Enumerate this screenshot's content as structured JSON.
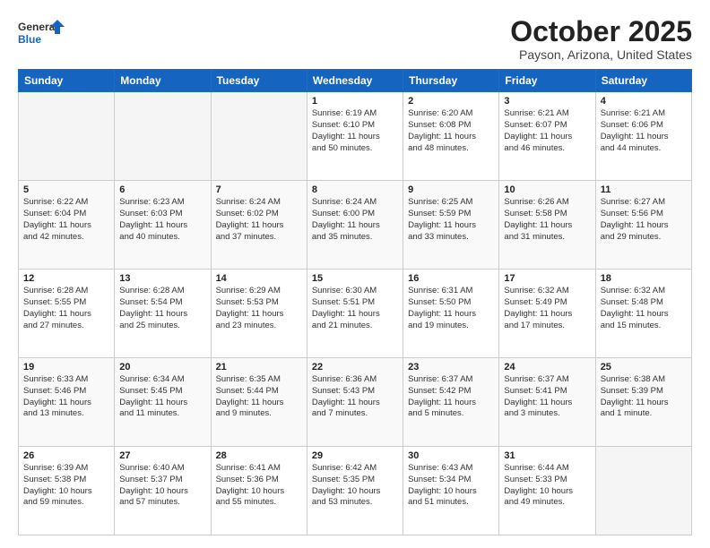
{
  "header": {
    "logo_general": "General",
    "logo_blue": "Blue",
    "month_title": "October 2025",
    "location": "Payson, Arizona, United States"
  },
  "weekdays": [
    "Sunday",
    "Monday",
    "Tuesday",
    "Wednesday",
    "Thursday",
    "Friday",
    "Saturday"
  ],
  "weeks": [
    [
      {
        "day": "",
        "info": ""
      },
      {
        "day": "",
        "info": ""
      },
      {
        "day": "",
        "info": ""
      },
      {
        "day": "1",
        "info": "Sunrise: 6:19 AM\nSunset: 6:10 PM\nDaylight: 11 hours\nand 50 minutes."
      },
      {
        "day": "2",
        "info": "Sunrise: 6:20 AM\nSunset: 6:08 PM\nDaylight: 11 hours\nand 48 minutes."
      },
      {
        "day": "3",
        "info": "Sunrise: 6:21 AM\nSunset: 6:07 PM\nDaylight: 11 hours\nand 46 minutes."
      },
      {
        "day": "4",
        "info": "Sunrise: 6:21 AM\nSunset: 6:06 PM\nDaylight: 11 hours\nand 44 minutes."
      }
    ],
    [
      {
        "day": "5",
        "info": "Sunrise: 6:22 AM\nSunset: 6:04 PM\nDaylight: 11 hours\nand 42 minutes."
      },
      {
        "day": "6",
        "info": "Sunrise: 6:23 AM\nSunset: 6:03 PM\nDaylight: 11 hours\nand 40 minutes."
      },
      {
        "day": "7",
        "info": "Sunrise: 6:24 AM\nSunset: 6:02 PM\nDaylight: 11 hours\nand 37 minutes."
      },
      {
        "day": "8",
        "info": "Sunrise: 6:24 AM\nSunset: 6:00 PM\nDaylight: 11 hours\nand 35 minutes."
      },
      {
        "day": "9",
        "info": "Sunrise: 6:25 AM\nSunset: 5:59 PM\nDaylight: 11 hours\nand 33 minutes."
      },
      {
        "day": "10",
        "info": "Sunrise: 6:26 AM\nSunset: 5:58 PM\nDaylight: 11 hours\nand 31 minutes."
      },
      {
        "day": "11",
        "info": "Sunrise: 6:27 AM\nSunset: 5:56 PM\nDaylight: 11 hours\nand 29 minutes."
      }
    ],
    [
      {
        "day": "12",
        "info": "Sunrise: 6:28 AM\nSunset: 5:55 PM\nDaylight: 11 hours\nand 27 minutes."
      },
      {
        "day": "13",
        "info": "Sunrise: 6:28 AM\nSunset: 5:54 PM\nDaylight: 11 hours\nand 25 minutes."
      },
      {
        "day": "14",
        "info": "Sunrise: 6:29 AM\nSunset: 5:53 PM\nDaylight: 11 hours\nand 23 minutes."
      },
      {
        "day": "15",
        "info": "Sunrise: 6:30 AM\nSunset: 5:51 PM\nDaylight: 11 hours\nand 21 minutes."
      },
      {
        "day": "16",
        "info": "Sunrise: 6:31 AM\nSunset: 5:50 PM\nDaylight: 11 hours\nand 19 minutes."
      },
      {
        "day": "17",
        "info": "Sunrise: 6:32 AM\nSunset: 5:49 PM\nDaylight: 11 hours\nand 17 minutes."
      },
      {
        "day": "18",
        "info": "Sunrise: 6:32 AM\nSunset: 5:48 PM\nDaylight: 11 hours\nand 15 minutes."
      }
    ],
    [
      {
        "day": "19",
        "info": "Sunrise: 6:33 AM\nSunset: 5:46 PM\nDaylight: 11 hours\nand 13 minutes."
      },
      {
        "day": "20",
        "info": "Sunrise: 6:34 AM\nSunset: 5:45 PM\nDaylight: 11 hours\nand 11 minutes."
      },
      {
        "day": "21",
        "info": "Sunrise: 6:35 AM\nSunset: 5:44 PM\nDaylight: 11 hours\nand 9 minutes."
      },
      {
        "day": "22",
        "info": "Sunrise: 6:36 AM\nSunset: 5:43 PM\nDaylight: 11 hours\nand 7 minutes."
      },
      {
        "day": "23",
        "info": "Sunrise: 6:37 AM\nSunset: 5:42 PM\nDaylight: 11 hours\nand 5 minutes."
      },
      {
        "day": "24",
        "info": "Sunrise: 6:37 AM\nSunset: 5:41 PM\nDaylight: 11 hours\nand 3 minutes."
      },
      {
        "day": "25",
        "info": "Sunrise: 6:38 AM\nSunset: 5:39 PM\nDaylight: 11 hours\nand 1 minute."
      }
    ],
    [
      {
        "day": "26",
        "info": "Sunrise: 6:39 AM\nSunset: 5:38 PM\nDaylight: 10 hours\nand 59 minutes."
      },
      {
        "day": "27",
        "info": "Sunrise: 6:40 AM\nSunset: 5:37 PM\nDaylight: 10 hours\nand 57 minutes."
      },
      {
        "day": "28",
        "info": "Sunrise: 6:41 AM\nSunset: 5:36 PM\nDaylight: 10 hours\nand 55 minutes."
      },
      {
        "day": "29",
        "info": "Sunrise: 6:42 AM\nSunset: 5:35 PM\nDaylight: 10 hours\nand 53 minutes."
      },
      {
        "day": "30",
        "info": "Sunrise: 6:43 AM\nSunset: 5:34 PM\nDaylight: 10 hours\nand 51 minutes."
      },
      {
        "day": "31",
        "info": "Sunrise: 6:44 AM\nSunset: 5:33 PM\nDaylight: 10 hours\nand 49 minutes."
      },
      {
        "day": "",
        "info": ""
      }
    ]
  ]
}
